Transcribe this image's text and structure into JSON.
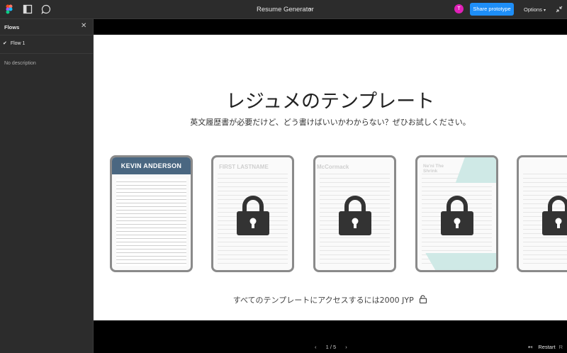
{
  "header": {
    "title": "Resume Generator",
    "avatar_letter": "T",
    "share_label": "Share prototype",
    "options_label": "Options"
  },
  "sidebar": {
    "heading": "Flows",
    "flow_name": "Flow 1",
    "description": "No description"
  },
  "frame": {
    "heading": "レジュメのテンプレート",
    "subheading": "英文履歴書が必要だけど、どう書けばいいかわからない？ぜひお試しください。",
    "templates": [
      {
        "name": "KEVIN ANDERSON",
        "locked": false
      },
      {
        "name": "FIRST LASTNAME",
        "locked": true
      },
      {
        "name": "McCormack",
        "locked": true
      },
      {
        "name": "Ne'ni The Shrink",
        "locked": true
      },
      {
        "name": "",
        "locked": true
      }
    ],
    "promo": "すべてのテンプレートにアクセスするには2000 JYP"
  },
  "footer": {
    "pager": "1 / 5",
    "restart_label": "Restart",
    "restart_key": "R"
  },
  "colors": {
    "accent": "#1e8ef7",
    "avatar": "#e020b8",
    "banner": "#4a6781"
  }
}
